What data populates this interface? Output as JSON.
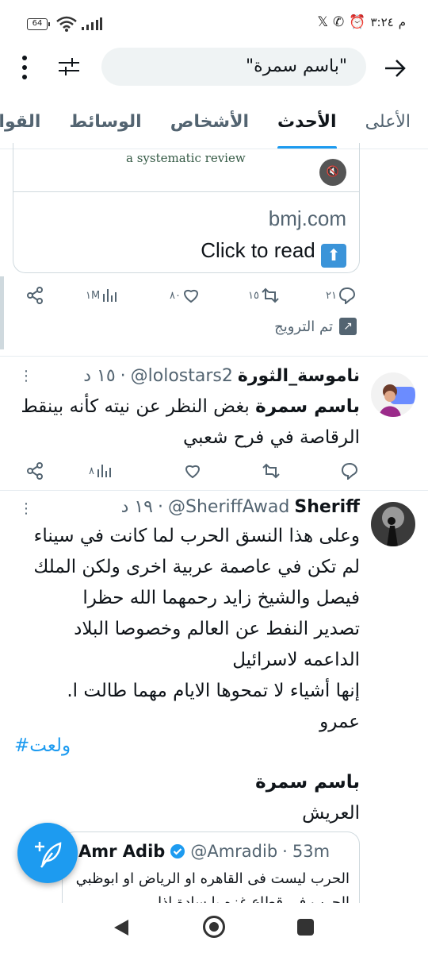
{
  "status_bar": {
    "battery": "64",
    "time": "٣:٢٤",
    "period": "م"
  },
  "search": {
    "query": "\"باسم سمرة\""
  },
  "tabs": [
    {
      "label": "الأعلى"
    },
    {
      "label": "الأحدث"
    },
    {
      "label": "الأشخاص"
    },
    {
      "label": "الوسائط"
    },
    {
      "label": "القوائم"
    }
  ],
  "card": {
    "image_caption": "a systematic review",
    "domain": "bmj.com",
    "title": "Click to read",
    "title_emoji": "⬆"
  },
  "tweet0_actions": {
    "replies": "٢١",
    "retweets": "١٥",
    "likes": "٨٠",
    "views": "١M"
  },
  "retweet_banner": {
    "label": "تم الترويج"
  },
  "tweet1": {
    "name": "ناموسة_الثورة",
    "handle": "@lolostars2",
    "time": "١٥ د",
    "body_bold": "باسم سمرة",
    "body_rest": "بغض النظر عن نيته كأنه بينقط الرقاصة في فرح شعبي",
    "views": "٨"
  },
  "tweet2": {
    "name": "Sheriff",
    "handle": "@SheriffAwad",
    "time": "١٩ د",
    "body_lines": [
      "وعلى هذا النسق الحرب لما كانت في سيناء",
      "لم تكن في عاصمة عربية اخرى ولكن الملك",
      "فيصل والشيخ زايد رحمهما الله حظرا",
      "تصدير النفط عن العالم وخصوصا البلاد",
      "الداعمه لاسرائيل",
      "إنها أشياء لا تمحوها الايام مهما طالت ا.",
      "عمرو"
    ],
    "hashtag": "#ولعت",
    "line_bold": "باسم سمرة",
    "line_last": "العريش"
  },
  "quoted": {
    "name": "Amr Adib",
    "handle": "@Amradib",
    "time": "53m",
    "text": "الحرب ليست فى القاهره او الرياض او ابوظبي الحرب في قطاع غزه يا سادة اذا"
  },
  "colors": {
    "accent": "#1d9bf0",
    "text": "#0f1419",
    "muted": "#536471"
  }
}
